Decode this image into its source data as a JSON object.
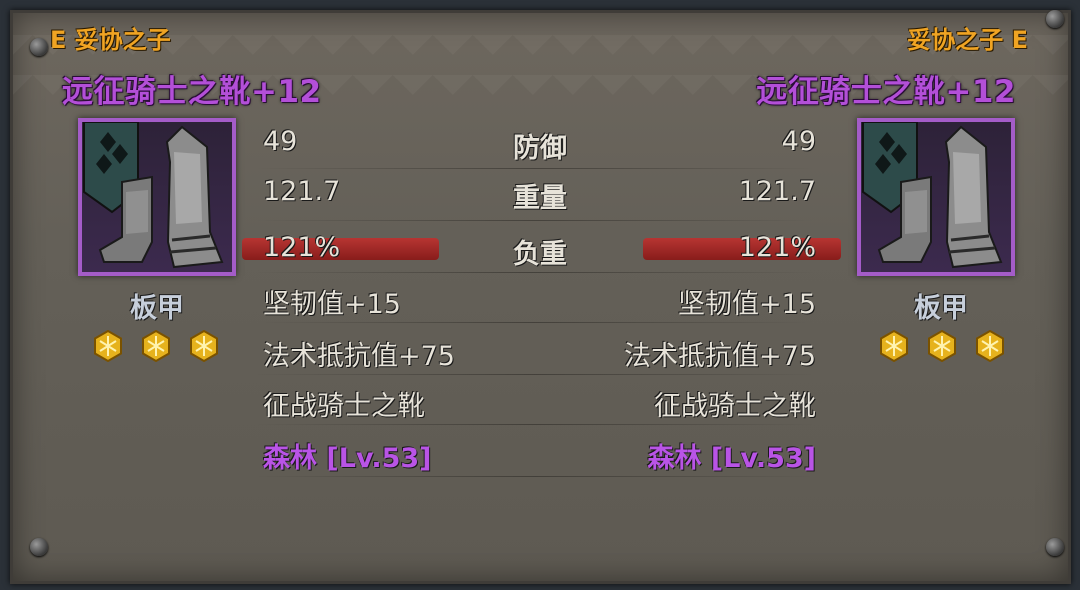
{
  "left": {
    "owner_label": "E 妥协之子",
    "item_name": "远征骑士之靴+12",
    "type": "板甲",
    "defense": "49",
    "weight": "121.7",
    "load": "121%",
    "stat1": "坚韧值+15",
    "stat2": "法术抵抗值+75",
    "set_name": "征战骑士之靴",
    "source": "森林 [Lv.53]",
    "gems": [
      "gold-gem-icon",
      "gold-gem-icon",
      "gold-gem-icon"
    ]
  },
  "right": {
    "owner_label": "妥协之子 E",
    "item_name": "远征骑士之靴+12",
    "type": "板甲",
    "defense": "49",
    "weight": "121.7",
    "load": "121%",
    "stat1": "坚韧值+15",
    "stat2": "法术抵抗值+75",
    "set_name": "征战骑士之靴",
    "source": "森林 [Lv.53]",
    "gems": [
      "gold-gem-icon",
      "gold-gem-icon",
      "gold-gem-icon"
    ]
  },
  "labels": {
    "defense": "防御",
    "weight": "重量",
    "load": "负重"
  },
  "colors": {
    "owner": "#f0a423",
    "item_name": "#b34fd8",
    "source": "#b954e6",
    "load_bar": "#b0201f",
    "gem": "#e6b21d"
  }
}
